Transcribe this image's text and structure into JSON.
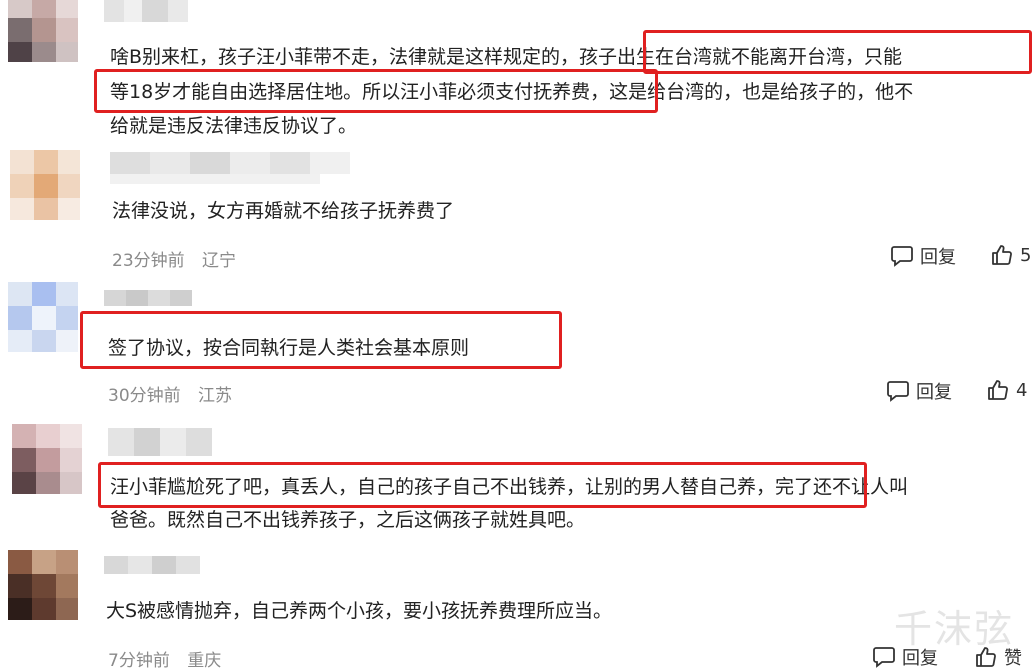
{
  "comments": [
    {
      "text_lines": [
        "啥B别来杠，孩子汪小菲带不走，法律就是这样规定的，孩子出生在台湾就不能离开台湾，只能",
        "等18岁才能自由选择居住地。所以汪小菲必须支付抚养费，这是给台湾的，也是给孩子的，他不",
        "给就是违反法律违反协议了。"
      ]
    },
    {
      "text": "法律没说，女方再婚就不给孩子抚养费了",
      "time": "23分钟前",
      "location": "辽宁",
      "reply_label": "回复",
      "like_count": "5"
    },
    {
      "text": "签了协议，按合同執行是人类社会基本原则",
      "time": "30分钟前",
      "location": "江苏",
      "reply_label": "回复",
      "like_count": "4"
    },
    {
      "text_lines": [
        "汪小菲尴尬死了吧，真丢人，自己的孩子自己不出钱养，让别的男人替自己养，完了还不让人叫",
        "爸爸。既然自己不出钱养孩子，之后这俩孩子就姓具吧。"
      ]
    },
    {
      "text": "大S被感情抛弃，自己养两个小孩，要小孩抚养费理所应当。",
      "time": "7分钟前",
      "location": "重庆",
      "reply_label": "回复",
      "like_label": "赞"
    }
  ],
  "watermark": "千沫弦",
  "colors": {
    "highlight_box": "#e02020",
    "meta_text": "#8a8a8a",
    "body_text": "#222222"
  },
  "icons": [
    "reply-bubble-icon",
    "thumbs-up-icon"
  ]
}
